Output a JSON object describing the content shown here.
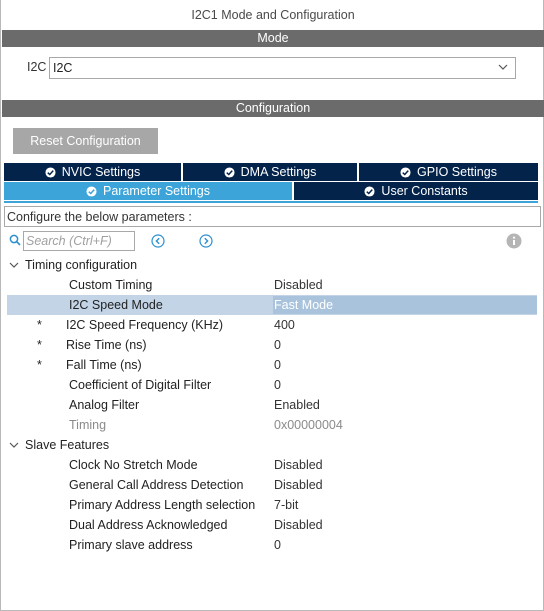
{
  "window_title": "I2C1 Mode and Configuration",
  "mode_header": "Mode",
  "mode": {
    "label": "I2C",
    "value": "I2C"
  },
  "configuration_header": "Configuration",
  "reset_button": "Reset Configuration",
  "tabs_row1": [
    {
      "label": "NVIC Settings",
      "active": false
    },
    {
      "label": "DMA Settings",
      "active": false
    },
    {
      "label": "GPIO Settings",
      "active": false
    }
  ],
  "tabs_row2": [
    {
      "label": "Parameter Settings",
      "active": true
    },
    {
      "label": "User Constants",
      "active": false
    }
  ],
  "description": "Configure the below parameters :",
  "search": {
    "placeholder": "Search (Ctrl+F)"
  },
  "groups": [
    {
      "title": "Timing configuration",
      "rows": [
        {
          "name": "Custom Timing",
          "value": "Disabled",
          "required": false,
          "selected": false,
          "disabled": false
        },
        {
          "name": "I2C Speed Mode",
          "value": "Fast Mode",
          "required": false,
          "selected": true,
          "disabled": false
        },
        {
          "name": "I2C Speed Frequency (KHz)",
          "value": "400",
          "required": true,
          "selected": false,
          "disabled": false
        },
        {
          "name": "Rise Time (ns)",
          "value": "0",
          "required": true,
          "selected": false,
          "disabled": false
        },
        {
          "name": "Fall Time (ns)",
          "value": "0",
          "required": true,
          "selected": false,
          "disabled": false
        },
        {
          "name": "Coefficient of Digital Filter",
          "value": "0",
          "required": false,
          "selected": false,
          "disabled": false
        },
        {
          "name": "Analog Filter",
          "value": "Enabled",
          "required": false,
          "selected": false,
          "disabled": false
        },
        {
          "name": "Timing",
          "value": "0x00000004",
          "required": false,
          "selected": false,
          "disabled": true
        }
      ]
    },
    {
      "title": "Slave Features",
      "rows": [
        {
          "name": "Clock No Stretch Mode",
          "value": "Disabled",
          "required": false,
          "selected": false,
          "disabled": false
        },
        {
          "name": "General Call Address Detection",
          "value": "Disabled",
          "required": false,
          "selected": false,
          "disabled": false
        },
        {
          "name": "Primary Address Length selection",
          "value": "7-bit",
          "required": false,
          "selected": false,
          "disabled": false
        },
        {
          "name": "Dual Address Acknowledged",
          "value": "Disabled",
          "required": false,
          "selected": false,
          "disabled": false
        },
        {
          "name": "Primary slave address",
          "value": "0",
          "required": false,
          "selected": false,
          "disabled": false
        }
      ]
    }
  ],
  "colors": {
    "section_header": "#6b6b6b",
    "tab_dark": "#03234b",
    "tab_active": "#3ca4d8",
    "selected_row": "#c2d4e6",
    "button_grey": "#a7a7a7"
  },
  "icons": {
    "search": "search-icon",
    "prev": "arrow-left-circle-icon",
    "next": "arrow-right-circle-icon",
    "info": "info-icon",
    "check": "check-circle-icon",
    "dropdown": "chevron-down-icon"
  }
}
